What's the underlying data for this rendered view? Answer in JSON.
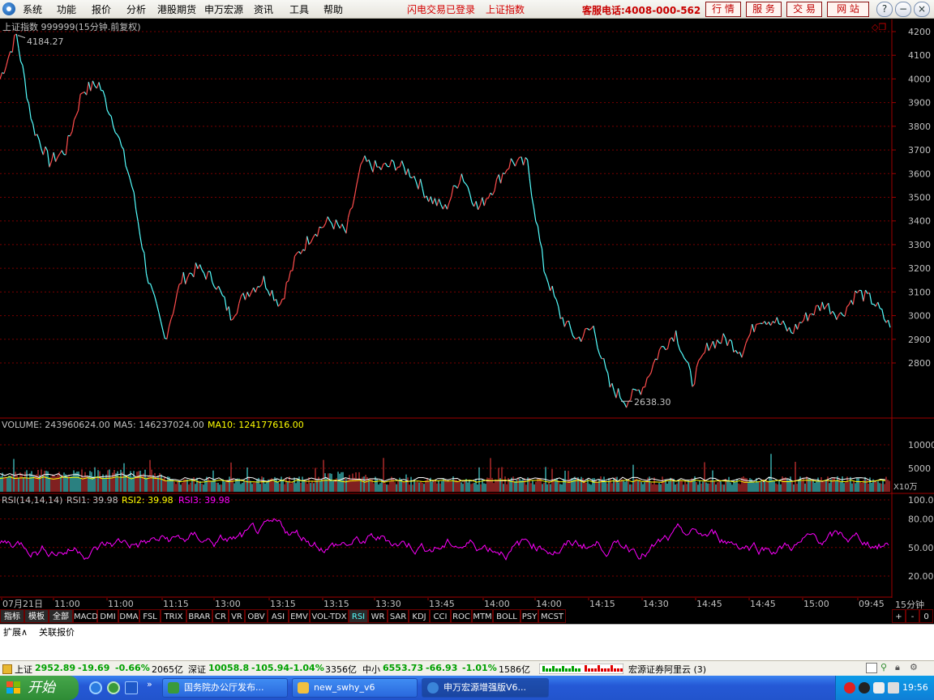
{
  "menubar": {
    "items": [
      "系统",
      "功能",
      "报价",
      "分析",
      "港股期货",
      "申万宏源",
      "资讯",
      "工具",
      "帮助"
    ],
    "status_login": "闪电交易已登录",
    "status_index": "上证指数",
    "hotline": "客服电话:4008-000-562",
    "nav_buttons": [
      "行 情",
      "服 务",
      "交 易",
      "网 站"
    ],
    "window_buttons": [
      "?",
      "−",
      "❐",
      "×"
    ]
  },
  "chart": {
    "header": "上证指数 999999(15分钟.前复权)",
    "high_label": "4184.27",
    "low_label": "2638.30",
    "price_ticks": [
      "4200",
      "4100",
      "4000",
      "3900",
      "3800",
      "3700",
      "3600",
      "3500",
      "3400",
      "3300",
      "3200",
      "3100",
      "3000",
      "2900",
      "2800"
    ],
    "volume_header": {
      "prefix": "VOLUME: 243960624.00",
      "ma5": "MA5: 146237024.00",
      "ma10": "MA10: 124177616.00"
    },
    "volume_ticks": [
      "10000",
      "5000"
    ],
    "volume_unit": "X10万",
    "rsi_header": {
      "prefix": "RSI(14,14,14)",
      "rsi1": "RSI1: 39.98",
      "rsi2": "RSI2: 39.98",
      "rsi3": "RSI3: 39.98"
    },
    "rsi_ticks": [
      "100.00",
      "80.00",
      "50.00",
      "20.00"
    ],
    "time_labels": [
      "07月21日",
      "11:00",
      "11:00",
      "11:15",
      "13:00",
      "13:15",
      "13:15",
      "13:30",
      "13:45",
      "14:00",
      "14:00",
      "14:15",
      "14:30",
      "14:45",
      "14:45",
      "15:00",
      "09:45"
    ],
    "period": "15分钟",
    "colors": {
      "price_up": "#ff4d4d",
      "price_down": "#54ffff",
      "volume_bar_up": "#ff4040",
      "volume_bar_down": "#54ffff",
      "ma5": "#ffffff",
      "ma10": "#ffff00",
      "rsi": "#ff00ff",
      "grid": "#7a0000"
    }
  },
  "chart_data": {
    "type": "line",
    "title": "上证指数 999999(15分钟.前复权)",
    "series": [
      {
        "name": "上证指数",
        "values": [
          4000,
          4184.27,
          3800,
          3650,
          3700,
          3950,
          3980,
          3800,
          3550,
          3150,
          2900,
          3150,
          3200,
          3150,
          3000,
          3100,
          3150,
          3050,
          3250,
          3350,
          3400,
          3350,
          3650,
          3620,
          3640,
          3600,
          3500,
          3450,
          3600,
          3450,
          3550,
          3650,
          3640,
          3200,
          3000,
          2900,
          2950,
          2700,
          2638.3,
          2700,
          2850,
          2930,
          2720,
          2880,
          2900,
          2850,
          2990,
          2980,
          2930,
          3000,
          3050,
          3000,
          3100,
          3060,
          2950
        ]
      }
    ],
    "ylim": [
      2600,
      4250
    ],
    "highest": 4184.27,
    "lowest": 2638.3
  },
  "tabs": [
    "指标",
    "模板",
    "全部",
    "MACD",
    "DMI",
    "DMA",
    "FSL",
    "TRIX",
    "BRAR",
    "CR",
    "VR",
    "OBV",
    "ASI",
    "EMV",
    "VOL-TDX",
    "RSI",
    "WR",
    "SAR",
    "KDJ",
    "CCI",
    "ROC",
    "MTM",
    "BOLL",
    "PSY",
    "MCST"
  ],
  "tab_controls": [
    "+",
    "-",
    "0"
  ],
  "ext_row": [
    "扩展∧",
    "关联报价"
  ],
  "statusbar": {
    "sh": {
      "name": "上证",
      "price": "2952.89",
      "chg": "-19.69",
      "pct": "-0.66%",
      "amt": "2065亿"
    },
    "sz": {
      "name": "深证",
      "price": "10058.8",
      "chg": "-105.94",
      "pct": "-1.04%",
      "amt": "3356亿"
    },
    "zx": {
      "name": "中小",
      "price": "6553.73",
      "chg": "-66.93",
      "pct": "-1.01%",
      "amt": "1586亿"
    },
    "server": "宏源证券阿里云 (3)"
  },
  "taskbar": {
    "start": "开始",
    "tasks": [
      "国务院办公厅发布...",
      "new_swhy_v6",
      "申万宏源增强版V6..."
    ],
    "clock": "19:56"
  }
}
